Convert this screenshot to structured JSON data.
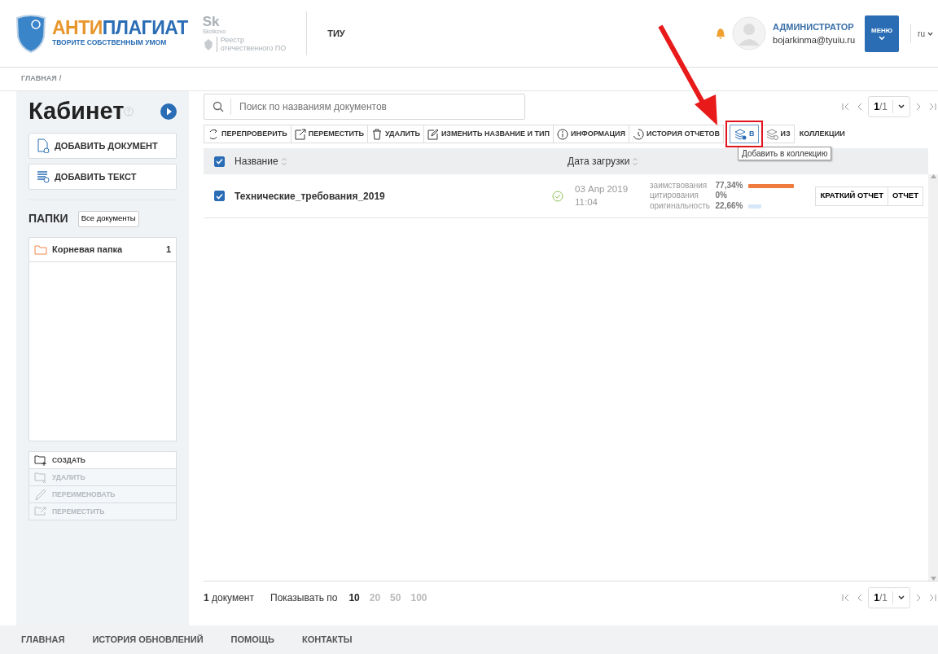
{
  "header": {
    "logo": {
      "title_parts": [
        "АНТИ",
        "ПЛАГИАТ"
      ],
      "tagline": "ТВОРИТЕ СОБСТВЕННЫМ УМОМ"
    },
    "partner": {
      "sk": "Sk",
      "sk_caption": "Skolkovo",
      "registry": [
        "Реестр",
        "отечественного ПО"
      ]
    },
    "organization": "ТИУ",
    "user": {
      "role": "АДМИНИСТРАТОР",
      "email": "bojarkinma@tyuiu.ru"
    },
    "menu_button": "МЕНЮ",
    "language": "ru"
  },
  "breadcrumb": {
    "items": [
      "ГЛАВНАЯ"
    ],
    "separator": "/"
  },
  "sidebar": {
    "title": "Кабинет",
    "add_buttons": [
      {
        "kind": "document",
        "label": "ДОБАВИТЬ ДОКУМЕНТ"
      },
      {
        "kind": "text",
        "label": "ДОБАВИТЬ ТЕКСТ"
      }
    ],
    "folders_title": "ПАПКИ",
    "all_documents": "Все документы",
    "folders": [
      {
        "name": "Корневая папка",
        "count": "1",
        "selected": false
      }
    ],
    "folder_actions": [
      {
        "kind": "create",
        "label": "СОЗДАТЬ",
        "disabled": false
      },
      {
        "kind": "delete",
        "label": "УДАЛИТЬ",
        "disabled": true
      },
      {
        "kind": "rename",
        "label": "ПЕРЕИМЕНОВАТЬ",
        "disabled": true
      },
      {
        "kind": "move",
        "label": "ПЕРЕМЕСТИТЬ",
        "disabled": true
      }
    ]
  },
  "search": {
    "placeholder": "Поиск по названиям документов"
  },
  "pager_top": {
    "page": "1",
    "total": "/1"
  },
  "toolbar": [
    {
      "kind": "recheck",
      "label": "ПЕРЕПРОВЕРИТЬ"
    },
    {
      "kind": "move",
      "label": "ПЕРЕМЕСТИТЬ"
    },
    {
      "kind": "delete",
      "label": "УДАЛИТЬ"
    },
    {
      "kind": "rename",
      "label": "ИЗМЕНИТЬ НАЗВАНИЕ И ТИП"
    },
    {
      "kind": "info",
      "label": "ИНФОРМАЦИЯ"
    },
    {
      "kind": "history",
      "label": "ИСТОРИЯ ОТЧЕТОВ"
    }
  ],
  "collections": {
    "buttons": [
      {
        "kind": "add",
        "label": "В",
        "highlighted": true
      },
      {
        "kind": "remove",
        "label": "ИЗ",
        "highlighted": false
      }
    ],
    "label": "КОЛЛЕКЦИИ",
    "tooltip": "Добавить в коллекцию"
  },
  "table": {
    "columns": [
      "Название",
      "Дата загрузки"
    ],
    "all_checked": true,
    "rows": [
      {
        "checked": true,
        "name": "Технические_требования_2019",
        "completed": true,
        "date": "03 Апр 2019",
        "time": "11:04",
        "stats": [
          {
            "kind": "borrowing",
            "label": "заимствования",
            "value": "77,34%"
          },
          {
            "kind": "citation",
            "label": "цитирования",
            "value": "0%"
          },
          {
            "kind": "originality",
            "label": "оригинальность",
            "value": "22,66%"
          }
        ],
        "actions": [
          "КРАТКИЙ ОТЧЕТ",
          "ОТЧЕТ"
        ]
      }
    ]
  },
  "footer_bar": {
    "count": "**1** документ",
    "show_label": "Показывать по",
    "page_sizes": [
      {
        "label": "10",
        "selected": true
      },
      {
        "label": "20",
        "selected": false
      },
      {
        "label": "50",
        "selected": false
      },
      {
        "label": "100",
        "selected": false
      }
    ]
  },
  "pager_bottom": {
    "page": "1",
    "total": "/1"
  },
  "footer_links": [
    "ГЛАВНАЯ",
    "ИСТОРИЯ ОБНОВЛЕНИЙ",
    "ПОМОЩЬ",
    "КОНТАКТЫ"
  ]
}
